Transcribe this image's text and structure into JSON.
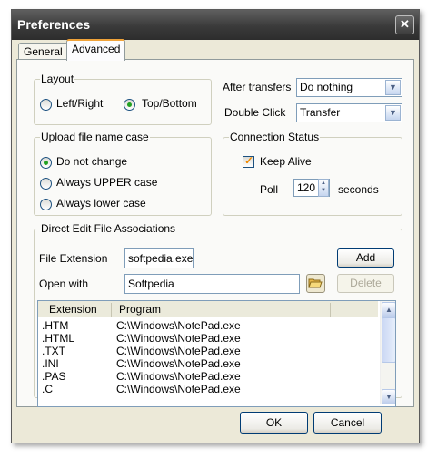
{
  "window": {
    "title": "Preferences",
    "close_glyph": "✕"
  },
  "tabs": [
    {
      "label": "General"
    },
    {
      "label": "Advanced",
      "active": true
    }
  ],
  "layout_group": {
    "legend": "Layout",
    "options": [
      {
        "label": "Left/Right",
        "selected": false
      },
      {
        "label": "Top/Bottom",
        "selected": true
      }
    ]
  },
  "after_transfers": {
    "label": "After transfers",
    "value": "Do nothing"
  },
  "double_click": {
    "label": "Double Click",
    "value": "Transfer"
  },
  "upload_case_group": {
    "legend": "Upload file name case",
    "options": [
      {
        "label": "Do not change",
        "selected": true
      },
      {
        "label": "Always UPPER case",
        "selected": false
      },
      {
        "label": "Always lower case",
        "selected": false
      }
    ]
  },
  "connection_status": {
    "legend": "Connection Status",
    "keep_alive_label": "Keep Alive",
    "keep_alive_checked": true,
    "poll_label": "Poll",
    "poll_value": "120",
    "poll_unit": "seconds"
  },
  "direct_edit": {
    "legend": "Direct Edit File Associations",
    "file_extension_label": "File Extension",
    "file_extension_value": "softpedia.exe",
    "open_with_label": "Open with",
    "open_with_value": "Softpedia",
    "add_label": "Add",
    "delete_label": "Delete",
    "columns": [
      "Extension",
      "Program"
    ],
    "rows": [
      {
        "ext": ".HTM",
        "program": "C:\\Windows\\NotePad.exe"
      },
      {
        "ext": ".HTML",
        "program": "C:\\Windows\\NotePad.exe"
      },
      {
        "ext": ".TXT",
        "program": "C:\\Windows\\NotePad.exe"
      },
      {
        "ext": ".INI",
        "program": "C:\\Windows\\NotePad.exe"
      },
      {
        "ext": ".PAS",
        "program": "C:\\Windows\\NotePad.exe"
      },
      {
        "ext": ".C",
        "program": "C:\\Windows\\NotePad.exe"
      }
    ]
  },
  "footer": {
    "ok_label": "OK",
    "cancel_label": "Cancel"
  },
  "colors": {
    "titlebar": "#3a3a3a",
    "dialog_bg": "#ece9d8",
    "tab_highlight": "#f0a33a",
    "radio_dot": "#21a121",
    "checkmark": "#f08a00",
    "button_border": "#003c74"
  },
  "icons": {
    "close": "close-icon",
    "browse": "folder-open-icon",
    "dropdown": "chevron-down-icon",
    "spin": "spin-arrows-icon"
  }
}
